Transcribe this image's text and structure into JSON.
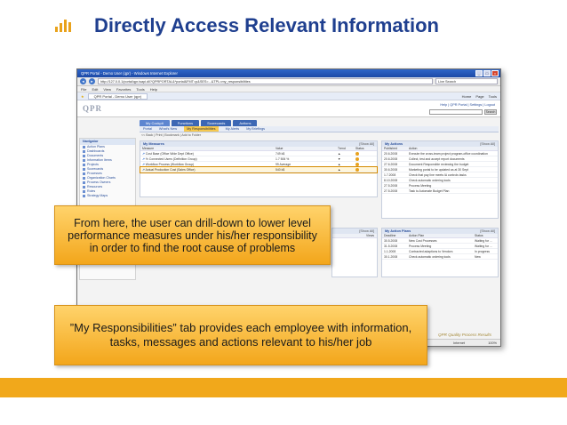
{
  "slide": {
    "title": "Directly Access Relevant Information",
    "accent": "#f1a81b",
    "title_color": "#1f3f8f"
  },
  "browser": {
    "window_title": "QPR Portal - Demo User (qpr) - Windows Internet Explorer",
    "address": "http://127.0.0.1/portal/qpr.isapi.dll?QPRPORTAL&*portal&FMT=p&SES=...&TPL=my_responsibilities",
    "search_provider": "Live Search",
    "menu": [
      "File",
      "Edit",
      "View",
      "Favorites",
      "Tools",
      "Help"
    ],
    "favorites_tab": "QPR Portal - Demo User (qpr)",
    "tools": [
      "Home",
      "Page",
      "Tools"
    ],
    "status_left": "Done",
    "status_zone": "Internet",
    "status_zoom": "100%"
  },
  "portal": {
    "logo": "QPR",
    "top_links": "Help | QPR Portal | Settings | Logout",
    "search_button": "Search",
    "tabs": [
      "My Cockpit",
      "Functions",
      "Scorecards",
      "Actions"
    ],
    "subtabs": [
      "Portal",
      "What's New",
      "My Responsibilities",
      "My Alerts",
      "My Briefings"
    ],
    "breadcrumb": "<< Back | Print | Bookmark | Add to Folder",
    "sidebar": {
      "heading": "Navigator",
      "items": [
        "Action Plans",
        "Dashboards",
        "Documents",
        "Information Items",
        "Projects",
        "Scorecards",
        "Processes",
        "Organization Charts",
        "Process Owners",
        "Resources",
        "Roles",
        "Strategy Maps"
      ]
    },
    "measures": {
      "heading": "My Measures",
      "show": "[Show All]",
      "columns": [
        "Measure",
        "Value",
        "Trend",
        "Status"
      ],
      "rows": [
        {
          "name": "Cost Base (Office Wide Dept Office)",
          "value": "749 k$",
          "status_color": "#e8a21e"
        },
        {
          "name": "% Connected Users (Definition Group)",
          "value": "1.7 506 %",
          "status_color": "#e8a21e"
        },
        {
          "name": "Workflow Process (Workflow Group)",
          "value": "99 Average",
          "status_color": "#e8a21e"
        },
        {
          "name": "Actual Production Cost (Sales Office)",
          "value": "540 k$",
          "status_color": "#e8a21e"
        }
      ]
    },
    "actions": {
      "heading": "My Actions",
      "show": "[Show All]",
      "columns": [
        "Published",
        "Action"
      ],
      "rows": [
        {
          "date": "20.6.2008",
          "text": "Execute the cross-team project program-office coordination"
        },
        {
          "date": "20.6.2008",
          "text": "Collect, test and accept report documents"
        },
        {
          "date": "27.6.2008",
          "text": "Document Responsible reviewing the budget"
        },
        {
          "date": "30.6.2008",
          "text": "Marketing portal to be updated as at 30 Sept"
        },
        {
          "date": "1.7.2008",
          "text": "Check that pay line meets IA controls tasks"
        },
        {
          "date": "8.10.2008",
          "text": "Check automatic ordering tools"
        },
        {
          "date": "27.5.2008",
          "text": "Process Meeting"
        },
        {
          "date": "27.5.2008",
          "text": "Task to Automate Budget Plan"
        }
      ]
    },
    "action_plans": {
      "heading": "My Action Plans",
      "show": "[Show All]",
      "columns": [
        "Deadline",
        "Action Plan",
        "Status"
      ],
      "rows": [
        {
          "date": "30.5.2008",
          "plan": "New Cost Processes",
          "status": "Waiting for ..."
        },
        {
          "date": "31.5.2008",
          "plan": "Process Meeting",
          "status": "Waiting for ..."
        },
        {
          "date": "1.1.2008",
          "plan": "Contracted adaptions to Vendors",
          "status": "In progress"
        },
        {
          "date": "30.1.2008",
          "plan": "Check automatic ordering tools",
          "status": "New"
        }
      ]
    },
    "mid_panel": {
      "show": "[Show All]",
      "columns": [
        "Views"
      ]
    },
    "footer_brand": "QPR Quality Process Results"
  },
  "callouts": {
    "drilldown": "From here, the user can drill-down to lower level performance measures under his/her responsibility in order to find the root cause of problems",
    "responsibilities": "”My Responsibilities” tab provides each employee with information, tasks, messages and actions relevant to his/her job"
  }
}
